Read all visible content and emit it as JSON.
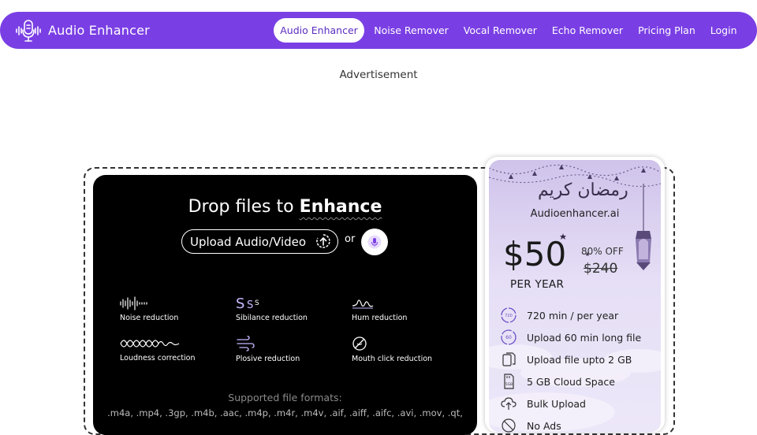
{
  "brand": {
    "name": "Audio Enhancer",
    "logo_icon": "microphone-waveform-icon"
  },
  "nav": {
    "items": [
      {
        "label": "Audio Enhancer",
        "active": true
      },
      {
        "label": "Noise Remover",
        "active": false
      },
      {
        "label": "Vocal Remover",
        "active": false
      },
      {
        "label": "Echo Remover",
        "active": false
      },
      {
        "label": "Pricing Plan",
        "active": false
      },
      {
        "label": "Login",
        "active": false
      }
    ]
  },
  "advertisement": "Advertisement",
  "upload": {
    "title_prefix": "Drop files to",
    "title_strong": "Enhance",
    "button_label": "Upload Audio/Video",
    "or_label": "or",
    "mic_icon": "microphone-icon"
  },
  "features": [
    {
      "label": "Noise reduction",
      "icon": "waveform-icon"
    },
    {
      "label": "Sibilance reduction",
      "icon": "sss-icon"
    },
    {
      "label": "Hum reduction",
      "icon": "hum-wave-icon"
    },
    {
      "label": "Loudness correction",
      "icon": "loudness-wave-icon"
    },
    {
      "label": "Plosive reduction",
      "icon": "wind-icon"
    },
    {
      "label": "Mouth click reduction",
      "icon": "no-click-icon"
    }
  ],
  "formats": {
    "title": "Supported file formats:",
    "list": ".m4a, .mp4, .3gp, .m4b, .aac, .m4p, .m4r, .m4v, .aif, .aiff, .aifc, .avi, .mov, .qt,"
  },
  "pricing": {
    "arabic_text": "رمضان كريم",
    "site_name": "Audioenhancer.ai",
    "price": "$50",
    "period": "PER YEAR",
    "discount": "80% OFF",
    "old_price": "$240",
    "perks": [
      {
        "label": "720 min / per year",
        "icon": "clock-720-icon"
      },
      {
        "label": "Upload 60 min long file",
        "icon": "clock-60-icon"
      },
      {
        "label": "Upload file upto 2 GB",
        "icon": "files-icon"
      },
      {
        "label": "5 GB Cloud Space",
        "icon": "sd-card-icon"
      },
      {
        "label": "Bulk Upload",
        "icon": "cloud-upload-icon"
      },
      {
        "label": "No Ads",
        "icon": "no-ads-icon"
      }
    ]
  },
  "colors": {
    "brand_purple": "#7a3fe4",
    "panel_black": "#000000",
    "card_lavender": "#e6dff6"
  }
}
